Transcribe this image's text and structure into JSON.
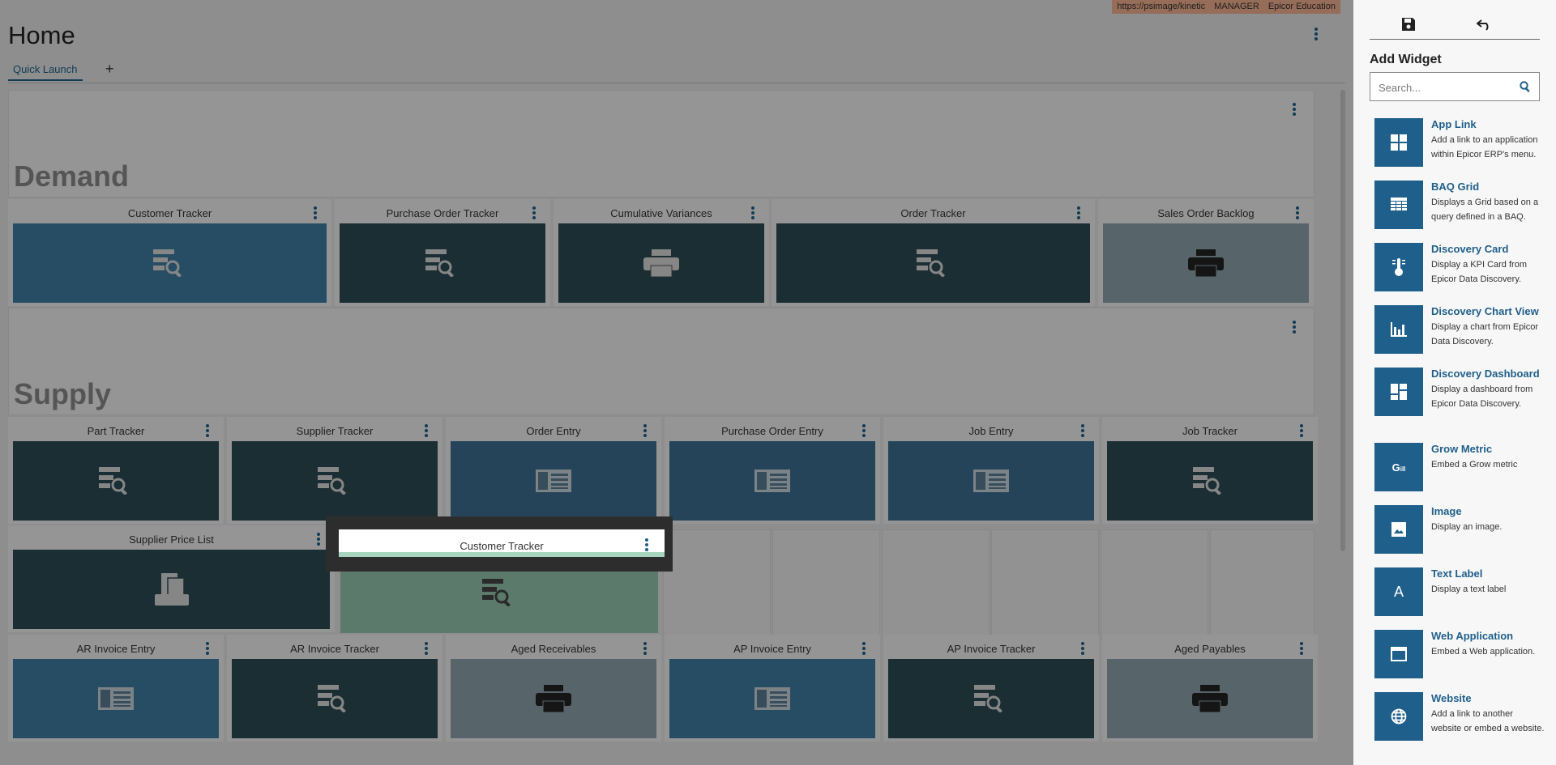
{
  "header": {
    "tenant": [
      "https://psimage/kinetic",
      "MANAGER",
      "Epicor Education"
    ],
    "title": "Home",
    "tabs": [
      {
        "label": "Quick Launch",
        "active": true
      }
    ],
    "add_tab_label": "+"
  },
  "sections": [
    {
      "label": "Demand"
    },
    {
      "label": "Supply"
    }
  ],
  "demand_cards": [
    {
      "title": "Customer Tracker",
      "icon": "tracker-icon",
      "color": "#3f7ca3"
    },
    {
      "title": "Purchase Order Tracker",
      "icon": "tracker-icon",
      "color": "#2c4b55"
    },
    {
      "title": "Cumulative Variances",
      "icon": "printer-icon",
      "color": "#2c4b55"
    },
    {
      "title": "Order Tracker",
      "icon": "tracker-icon",
      "color": "#2c4b55"
    },
    {
      "title": "Sales Order Backlog",
      "icon": "printer-icon",
      "color": "#8da4ad"
    }
  ],
  "supply_cards": [
    {
      "title": "Part Tracker",
      "icon": "tracker-icon",
      "color": "#2c4b55"
    },
    {
      "title": "Supplier Tracker",
      "icon": "tracker-icon",
      "color": "#2c4b55"
    },
    {
      "title": "Order Entry",
      "icon": "entry-form-icon",
      "color": "#3d6f92"
    },
    {
      "title": "Purchase Order Entry",
      "icon": "entry-form-icon",
      "color": "#3d6f92"
    },
    {
      "title": "Job Entry",
      "icon": "entry-form-icon",
      "color": "#3d6f92"
    },
    {
      "title": "Job Tracker",
      "icon": "tracker-icon",
      "color": "#2c4b55"
    }
  ],
  "extra_cards": [
    {
      "title": "Supplier Price List",
      "icon": "report-docs-icon",
      "color": "#2c4b55"
    }
  ],
  "bottom_cards": [
    {
      "title": "AR Invoice Entry",
      "icon": "entry-form-icon",
      "color": "#3f7ca3"
    },
    {
      "title": "AR Invoice Tracker",
      "icon": "tracker-icon",
      "color": "#2c4b55"
    },
    {
      "title": "Aged Receivables",
      "icon": "printer-icon",
      "color": "#8da4ad"
    },
    {
      "title": "AP Invoice Entry",
      "icon": "entry-form-icon",
      "color": "#3f7ca3"
    },
    {
      "title": "AP Invoice Tracker",
      "icon": "tracker-icon",
      "color": "#2c4b55"
    },
    {
      "title": "Aged Payables",
      "icon": "printer-icon",
      "color": "#8da4ad"
    }
  ],
  "dragging_card": {
    "title": "Customer Tracker",
    "icon": "tracker-icon"
  },
  "panel": {
    "title": "Add Widget",
    "search_placeholder": "Search...",
    "widgets": [
      {
        "name": "App Link",
        "desc": "Add a link to an application within Epicor ERP's menu.",
        "icon": "grid-icon"
      },
      {
        "name": "BAQ Grid",
        "desc": "Displays a Grid based on a query defined in a BAQ.",
        "icon": "table-icon"
      },
      {
        "name": "Discovery Card",
        "desc": "Display a KPI Card from Epicor Data Discovery.",
        "icon": "thermometer-icon"
      },
      {
        "name": "Discovery Chart View",
        "desc": "Display a chart from Epicor Data Discovery.",
        "icon": "bar-chart-icon"
      },
      {
        "name": "Discovery Dashboard",
        "desc": "Display a dashboard from Epicor Data Discovery.",
        "icon": "dashboard-icon"
      },
      {
        "name": "Grow Metric",
        "desc": "Embed a Grow metric",
        "icon": "grow-logo-icon"
      },
      {
        "name": "Image",
        "desc": "Display an image.",
        "icon": "image-icon"
      },
      {
        "name": "Text Label",
        "desc": "Display a text label",
        "icon": "text-icon"
      },
      {
        "name": "Web Application",
        "desc": "Embed a Web application.",
        "icon": "web-app-icon"
      },
      {
        "name": "Website",
        "desc": "Add a link to another website or embed a website.",
        "icon": "globe-icon"
      }
    ]
  }
}
